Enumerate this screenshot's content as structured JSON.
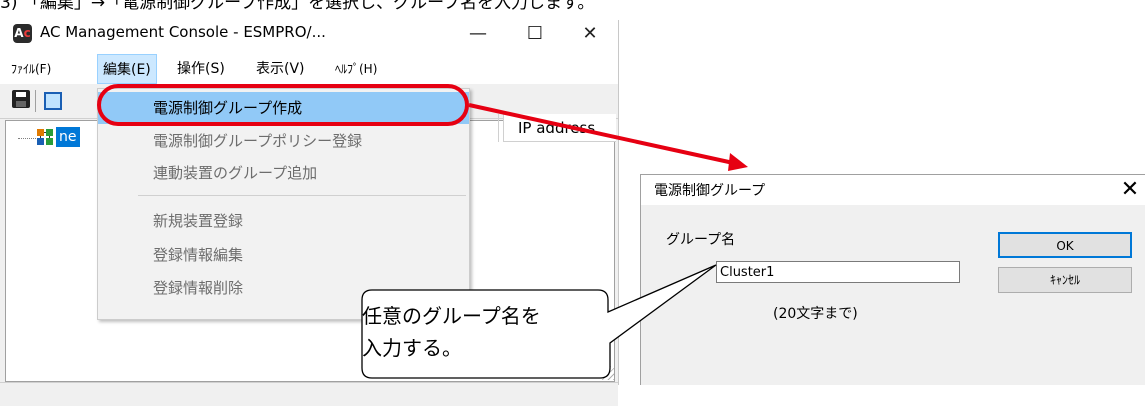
{
  "caption": "3) 「編集」→「電源制御グループ作成」を選択し、グループ名を入力します。",
  "window": {
    "title": "AC Management Console - ESMPRO/...",
    "minimize": "—",
    "maximize": "☐",
    "close": "✕"
  },
  "menubar": {
    "file": "ﾌｧｲﾙ(F)",
    "edit": "編集(E)",
    "operate": "操作(S)",
    "view": "表示(V)",
    "help": "ﾍﾙﾌﾟ(H)"
  },
  "tree": {
    "root_label": "ne"
  },
  "column": {
    "ip_address": "IP address"
  },
  "dropdown": {
    "items": [
      "電源制御グループ作成",
      "電源制御グループポリシー登録",
      "連動装置のグループ追加",
      "新規装置登録",
      "登録情報編集",
      "登録情報削除"
    ]
  },
  "dialog": {
    "title": "電源制御グループ",
    "close": "✕",
    "label": "グループ名",
    "input_value": "Cluster1",
    "hint": "(20文字まで)",
    "ok": "OK",
    "cancel": "ｷｬﾝｾﾙ"
  },
  "callout": {
    "line1": "任意のグループ名を",
    "line2": "入力する。"
  },
  "colors": {
    "highlight": "#91c9f7",
    "annotation_red": "#e60012",
    "selection_blue": "#0078d7"
  }
}
